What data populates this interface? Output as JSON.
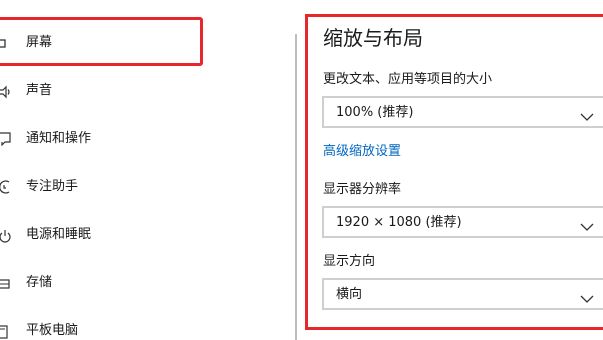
{
  "nav": {
    "items": [
      {
        "label": "屏幕",
        "icon": "display-icon",
        "selected": true
      },
      {
        "label": "声音",
        "icon": "sound-icon"
      },
      {
        "label": "通知和操作",
        "icon": "notification-icon"
      },
      {
        "label": "专注助手",
        "icon": "focus-assist-icon"
      },
      {
        "label": "电源和睡眠",
        "icon": "power-icon"
      },
      {
        "label": "存储",
        "icon": "storage-icon"
      },
      {
        "label": "平板电脑",
        "icon": "tablet-icon"
      }
    ]
  },
  "scale_section": {
    "title": "缩放与布局",
    "scale_label": "更改文本、应用等项目的大小",
    "scale_value": "100% (推荐)",
    "advanced_link": "高级缩放设置",
    "resolution_label": "显示器分辨率",
    "resolution_value": "1920 × 1080 (推荐)",
    "orientation_label": "显示方向",
    "orientation_value": "横向"
  },
  "colors": {
    "highlight": "#e8272c",
    "link": "#0067c0"
  }
}
